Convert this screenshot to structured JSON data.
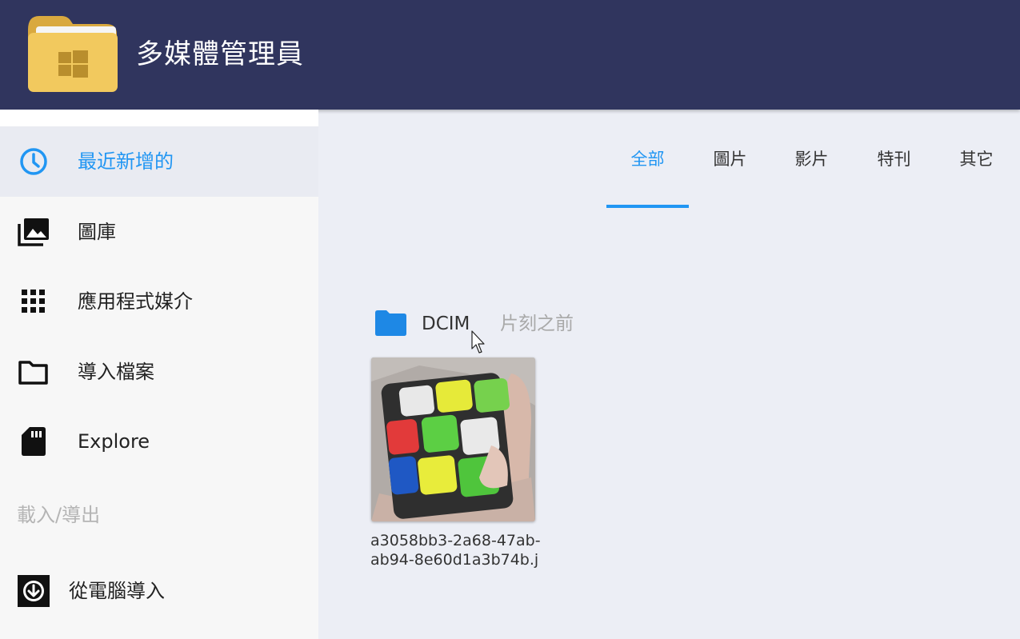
{
  "app": {
    "title": "多媒體管理員"
  },
  "sidebar": {
    "items": [
      {
        "label": "最近新增的",
        "icon": "clock-icon",
        "active": true
      },
      {
        "label": "圖庫",
        "icon": "photo-library-icon"
      },
      {
        "label": "應用程式媒介",
        "icon": "apps-grid-icon"
      },
      {
        "label": "導入檔案",
        "icon": "folder-outline-icon"
      },
      {
        "label": "Explore",
        "icon": "sd-card-icon"
      }
    ],
    "section_header": "載入/導出",
    "section_items": [
      {
        "label": "從電腦導入",
        "icon": "download-circle-icon"
      }
    ]
  },
  "tabs": [
    {
      "label": "全部",
      "active": true
    },
    {
      "label": "圖片"
    },
    {
      "label": "影片"
    },
    {
      "label": "特刊"
    },
    {
      "label": "其它"
    }
  ],
  "folder": {
    "name": "DCIM",
    "time": "片刻之前",
    "files": [
      {
        "name": "a3058bb3-2a68-47ab-ab94-8e60d1a3b74b.j"
      }
    ]
  },
  "colors": {
    "appbar": "#30355e",
    "accent": "#2196f3",
    "logo_folder": "#f2c95e"
  }
}
